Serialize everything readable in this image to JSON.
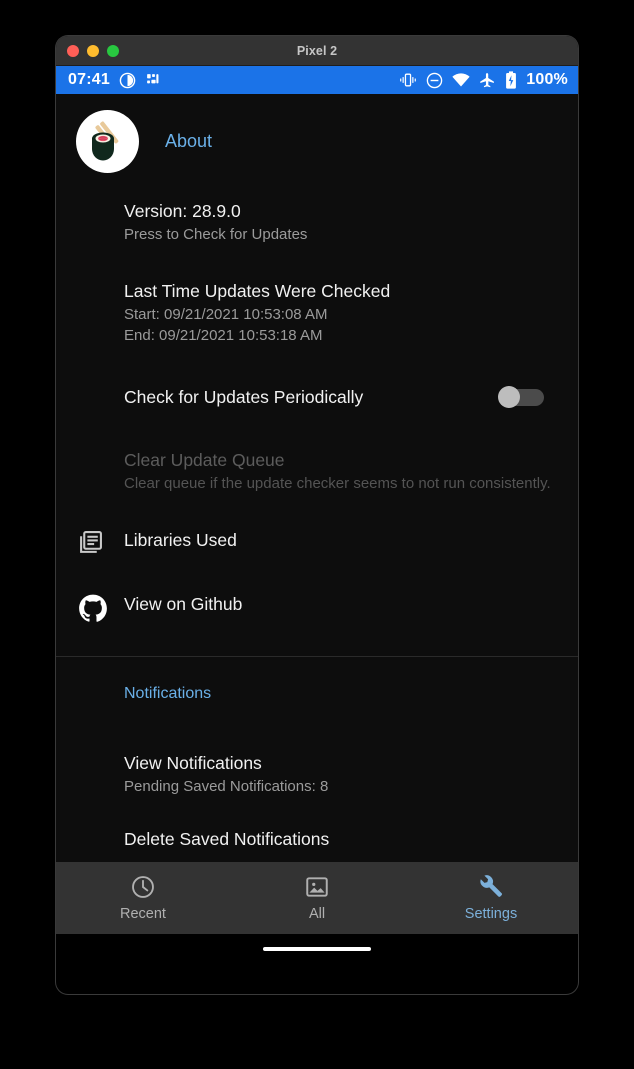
{
  "window": {
    "title": "Pixel 2",
    "traffic_lights": [
      "close",
      "minimize",
      "zoom"
    ]
  },
  "status_bar": {
    "time": "07:41",
    "battery_percent": "100%",
    "left_icons": [
      "contrast-circle-icon",
      "sensors-icon"
    ],
    "right_icons": [
      "vibrate-icon",
      "do-not-disturb-icon",
      "wifi-icon",
      "airplane-mode-icon",
      "battery-icon"
    ],
    "background_color": "#1b73e8"
  },
  "app_header": {
    "logo": "sushi-icon",
    "title": "About",
    "title_color": "#6ab0e8"
  },
  "about_section": {
    "version": {
      "title": "Version: 28.9.0",
      "subtitle": "Press to Check for Updates"
    },
    "last_checked": {
      "title": "Last Time Updates Were Checked",
      "start": "Start: 09/21/2021 10:53:08 AM",
      "end": "End: 09/21/2021 10:53:18 AM"
    },
    "periodic_updates": {
      "title": "Check for Updates Periodically",
      "toggle_state": "off"
    },
    "clear_queue": {
      "title": "Clear Update Queue",
      "subtitle": "Clear queue if the update checker seems to not run consistently.",
      "disabled": true
    },
    "libraries": {
      "title": "Libraries Used",
      "icon": "library-books-icon"
    },
    "github": {
      "title": "View on Github",
      "icon": "github-icon"
    }
  },
  "notifications_section": {
    "header": "Notifications",
    "header_color": "#6ab0e8",
    "view_notifications": {
      "title": "View Notifications",
      "subtitle": "Pending Saved Notifications: 8"
    },
    "delete_notifications": {
      "title": "Delete Saved Notifications"
    }
  },
  "bottom_nav": {
    "items": [
      {
        "label": "Recent",
        "icon": "clock-icon",
        "selected": false
      },
      {
        "label": "All",
        "icon": "image-icon",
        "selected": false
      },
      {
        "label": "Settings",
        "icon": "wrench-icon",
        "selected": true
      }
    ],
    "selected_color": "#7cb0da"
  }
}
